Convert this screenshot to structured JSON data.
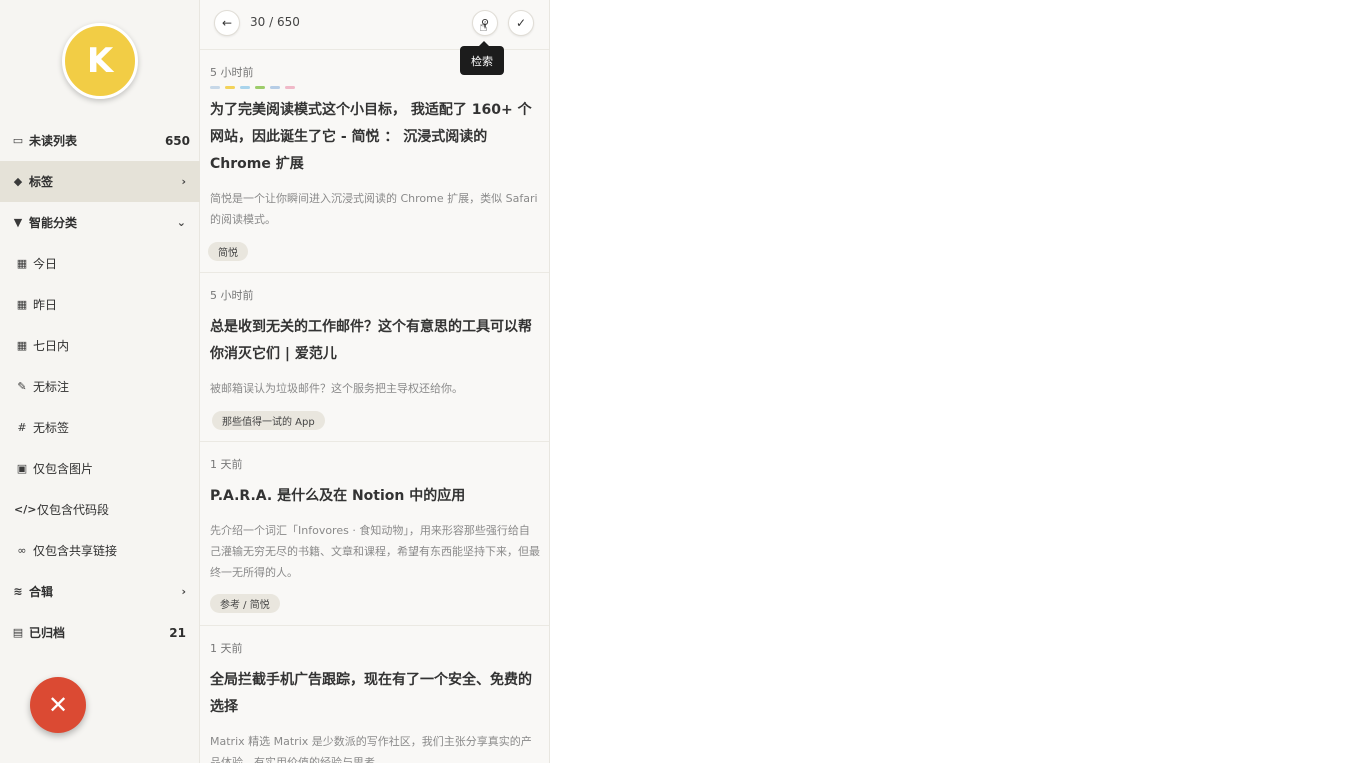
{
  "user": {
    "avatar_letter": "K",
    "avatar_color": "#f2cd45"
  },
  "sidebar": {
    "items": [
      {
        "label": "未读列表",
        "icon": "inbox-icon",
        "count": "650"
      },
      {
        "label": "标签",
        "icon": "tags-icon",
        "chevron": "right"
      },
      {
        "label": "智能分类",
        "icon": "filter-icon",
        "chevron": "down"
      },
      {
        "label": "今日",
        "icon": "calendar-icon"
      },
      {
        "label": "昨日",
        "icon": "calendar-icon"
      },
      {
        "label": "七日内",
        "icon": "calendar-icon"
      },
      {
        "label": "无标注",
        "icon": "highlighter-icon"
      },
      {
        "label": "无标签",
        "icon": "hashtag-icon"
      },
      {
        "label": "仅包含图片",
        "icon": "image-icon"
      },
      {
        "label": "仅包含代码段",
        "icon": "code-icon"
      },
      {
        "label": "仅包含共享链接",
        "icon": "link-icon"
      },
      {
        "label": "合辑",
        "icon": "layers-icon",
        "chevron": "right"
      },
      {
        "label": "已归档",
        "icon": "archive-icon",
        "count": "21"
      }
    ],
    "active_index": 1,
    "active_color": "#e5e2d8"
  },
  "fab": {
    "icon": "close-icon",
    "glyph": "✕",
    "color": "#db4a33"
  },
  "list": {
    "pager": "30 / 650",
    "back_icon": "arrow-left-icon",
    "search_icon": "search-icon",
    "check_icon": "check-icon",
    "tooltip": "检索",
    "articles": [
      {
        "time": "5 小时前",
        "title": "为了完美阅读模式这个小目标， 我适配了 160+ 个网站，因此诞生了它 - 简悦 ： 沉浸式阅读的 Chrome 扩展",
        "desc": "简悦是一个让你瞬间进入沉浸式阅读的 Chrome 扩展，类似 Safari 的阅读模式。",
        "tag": "简悦",
        "colors": [
          "#c7d8e8",
          "#f3d35a",
          "#a9d4ec",
          "#9dcc6a",
          "#b6cde6",
          "#f0b9c8"
        ]
      },
      {
        "time": "5 小时前",
        "title": "总是收到无关的工作邮件？这个有意思的工具可以帮你消灭它们 | 爱范儿",
        "desc": "被邮箱误认为垃圾邮件？这个服务把主导权还给你。",
        "tag": "那些值得一试的 App"
      },
      {
        "time": "1 天前",
        "title": "P.A.R.A. 是什么及在 Notion 中的应用",
        "desc": "先介绍一个词汇「Infovores · 食知动物」，用来形容那些强行给自己灌输无穷无尽的书籍、文章和课程，希望有东西能坚持下来，但最终一无所得的人。",
        "tag": "参考 / 简悦"
      },
      {
        "time": "1 天前",
        "title": "全局拦截手机广告跟踪，现在有了一个安全、免费的选择",
        "desc": "Matrix 精选 Matrix 是少数派的写作社区，我们主张分享真实的产品体验，有实用价值的经验与思考。"
      }
    ]
  }
}
